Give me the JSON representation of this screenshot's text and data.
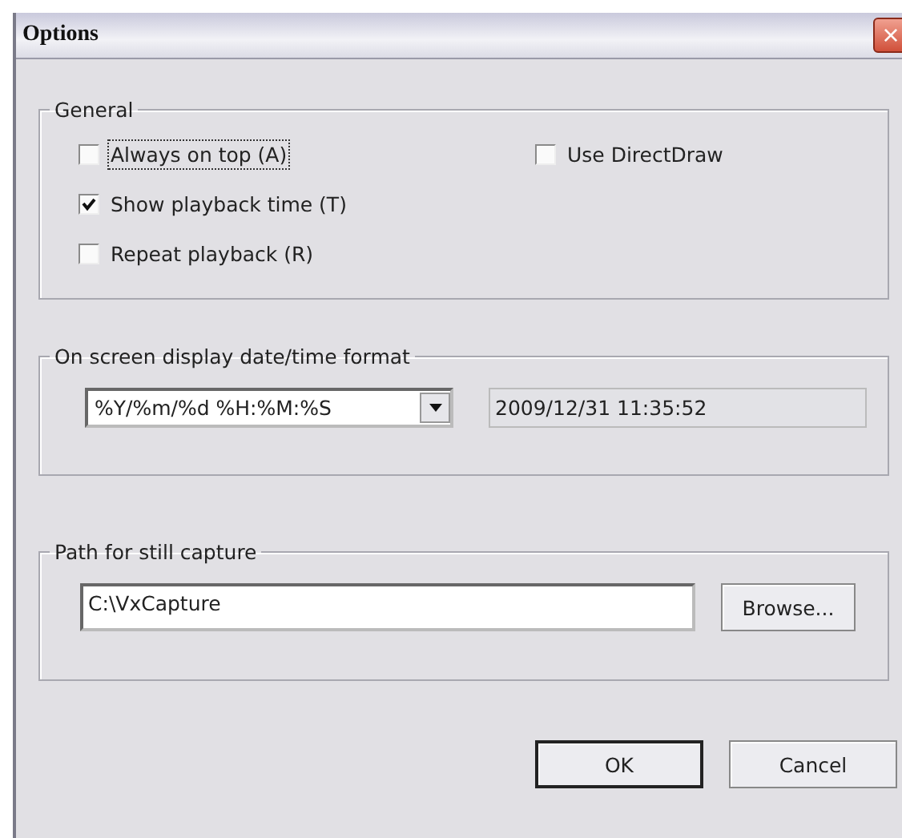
{
  "window": {
    "title": "Options",
    "close": "×"
  },
  "general": {
    "title": "General",
    "columns": [
      [
        {
          "label": "Always on top (A)",
          "checked": false,
          "focused": true
        },
        {
          "label": "Show playback time (T)",
          "checked": true,
          "focused": false
        },
        {
          "label": "Repeat playback (R)",
          "checked": false,
          "focused": false
        }
      ],
      [
        {
          "label": "Use DirectDraw",
          "checked": false,
          "focused": false
        }
      ]
    ]
  },
  "osd": {
    "title": "On screen display date/time format",
    "format": "%Y/%m/%d %H:%M:%S",
    "preview": "2009/12/31 11:35:52"
  },
  "capture": {
    "title": "Path for still capture",
    "path": "C:\\VxCapture",
    "browse": "Browse..."
  },
  "buttons": [
    {
      "label": "OK",
      "default": true
    },
    {
      "label": "Cancel",
      "default": false
    }
  ]
}
